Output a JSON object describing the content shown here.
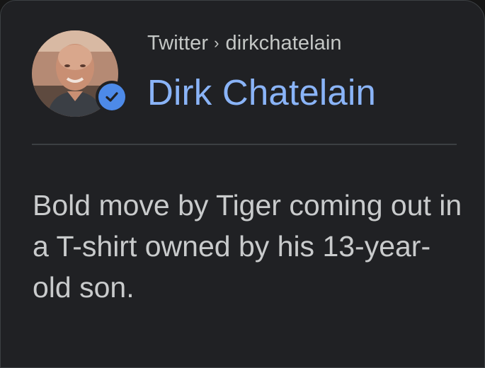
{
  "result": {
    "source": "Twitter",
    "separator": "›",
    "handle": "dirkchatelain",
    "author_name": "Dirk Chatelain",
    "verified": true,
    "avatar_icon": "profile-photo",
    "tweet_text": "Bold move by Tiger coming out in a T-shirt owned by his 13-year-old son."
  },
  "colors": {
    "background": "#202124",
    "name_link": "#8ab4f8",
    "verified_badge": "#4d8ae8",
    "text": "#c9cbcc",
    "divider": "#3c4043"
  }
}
